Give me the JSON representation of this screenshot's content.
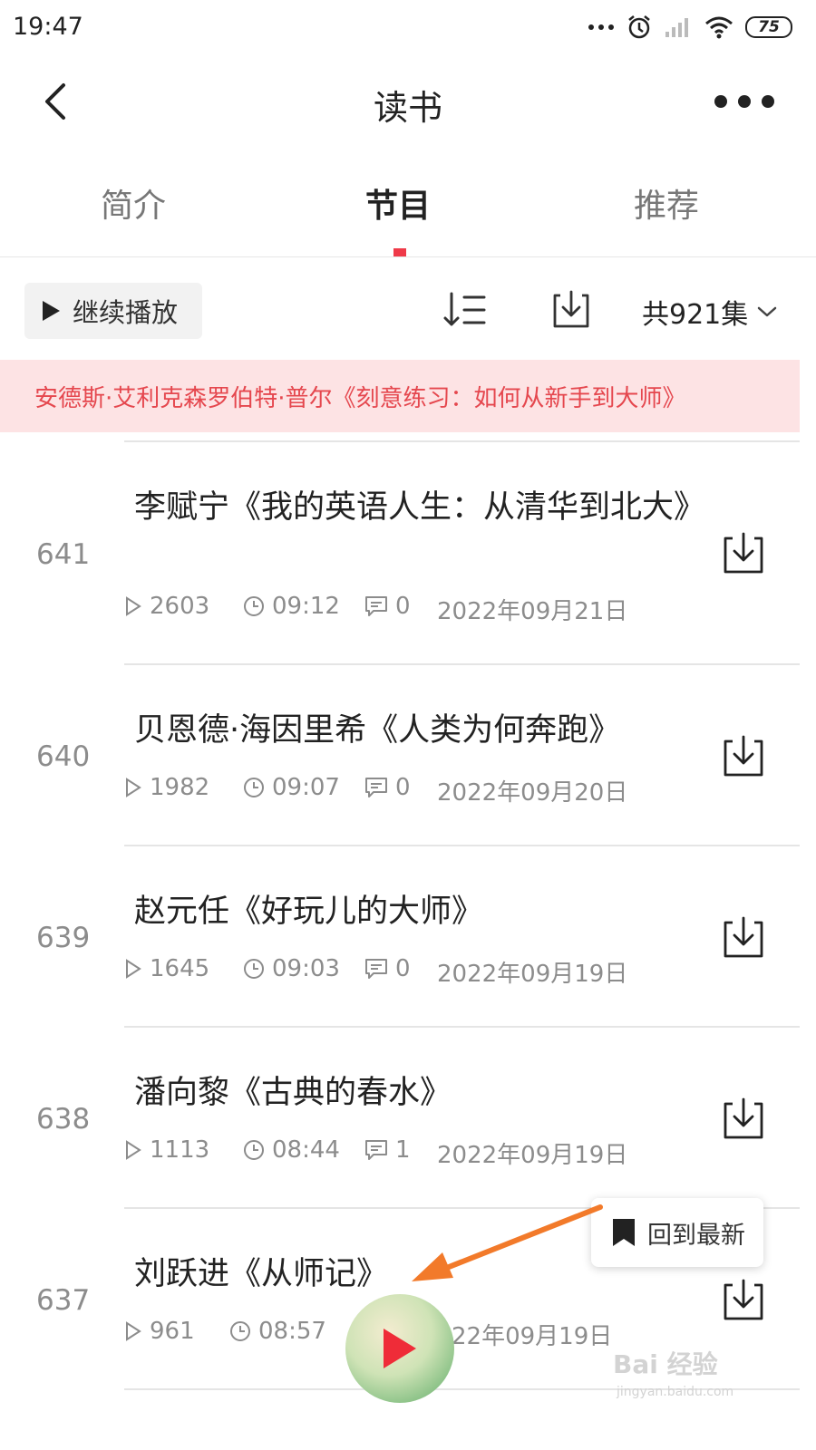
{
  "status_bar": {
    "time": "19:47",
    "battery": "75"
  },
  "nav": {
    "title": "读书"
  },
  "tabs": [
    {
      "label": "简介"
    },
    {
      "label": "节目"
    },
    {
      "label": "推荐"
    }
  ],
  "toolbar": {
    "continue_label": "继续播放",
    "episode_count": "共921集"
  },
  "banner": {
    "text": "安德斯·艾利克森罗伯特·普尔《刻意练习：如何从新手到大师》"
  },
  "episodes": [
    {
      "num": "641",
      "title": "李赋宁《我的英语人生：从清华到北大》",
      "plays": "2603",
      "duration": "09:12",
      "comments": "0",
      "date": "2022年09月21日"
    },
    {
      "num": "640",
      "title": "贝恩德·海因里希《人类为何奔跑》",
      "plays": "1982",
      "duration": "09:07",
      "comments": "0",
      "date": "2022年09月20日"
    },
    {
      "num": "639",
      "title": "赵元任《好玩儿的大师》",
      "plays": "1645",
      "duration": "09:03",
      "comments": "0",
      "date": "2022年09月19日"
    },
    {
      "num": "638",
      "title": "潘向黎《古典的春水》",
      "plays": "1113",
      "duration": "08:44",
      "comments": "1",
      "date": "2022年09月19日"
    },
    {
      "num": "637",
      "title": "刘跃进《从师记》",
      "plays": "961",
      "duration": "08:57",
      "comments": "",
      "date": "22年09月19日"
    }
  ],
  "floating": {
    "back_to_latest": "回到最新"
  },
  "watermark": {
    "brand": "Bai  经验",
    "url": "jingyan.baidu.com"
  },
  "colors": {
    "accent": "#ef3a49",
    "banner_bg": "#fde3e4",
    "banner_text": "#e5474e",
    "annotation_arrow": "#f27a2a"
  }
}
